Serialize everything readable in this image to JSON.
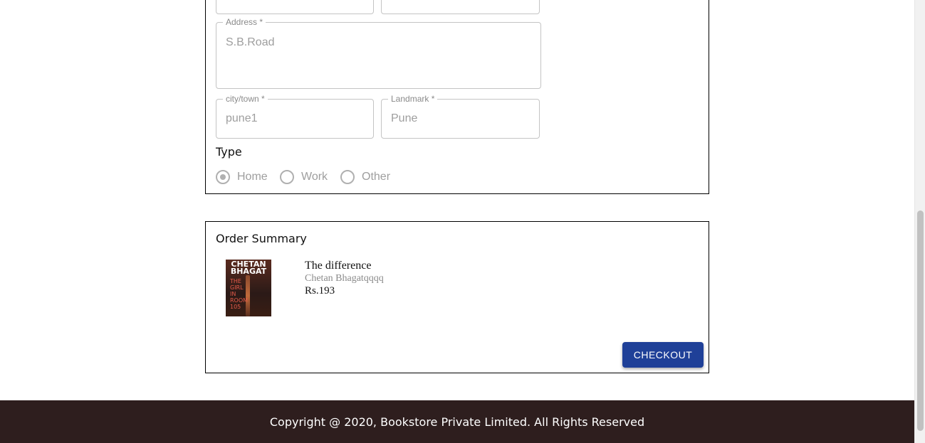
{
  "address_form": {
    "address": {
      "label": "Address *",
      "value": "S.B.Road"
    },
    "city": {
      "label": "city/town *",
      "value": "pune1"
    },
    "landmark": {
      "label": "Landmark *",
      "value": "Pune"
    },
    "type_heading": "Type",
    "type_options": [
      {
        "label": "Home",
        "checked": true
      },
      {
        "label": "Work",
        "checked": false
      },
      {
        "label": "Other",
        "checked": false
      }
    ]
  },
  "order_summary": {
    "heading": "Order Summary",
    "item": {
      "title": "The difference",
      "author": "Chetan Bhagatqqqq",
      "price": "Rs.193",
      "cover": {
        "author_text": "CHETAN BHAGAT",
        "subtitle_text": "THE GIRL IN ROOM 105"
      }
    },
    "checkout_label": "CHECKOUT"
  },
  "footer": {
    "copyright": "Copyright @ 2020, Bookstore Private Limited. All Rights Reserved"
  },
  "colors": {
    "checkout_button": "#1f4098",
    "footer_background": "#2e1e1e"
  }
}
